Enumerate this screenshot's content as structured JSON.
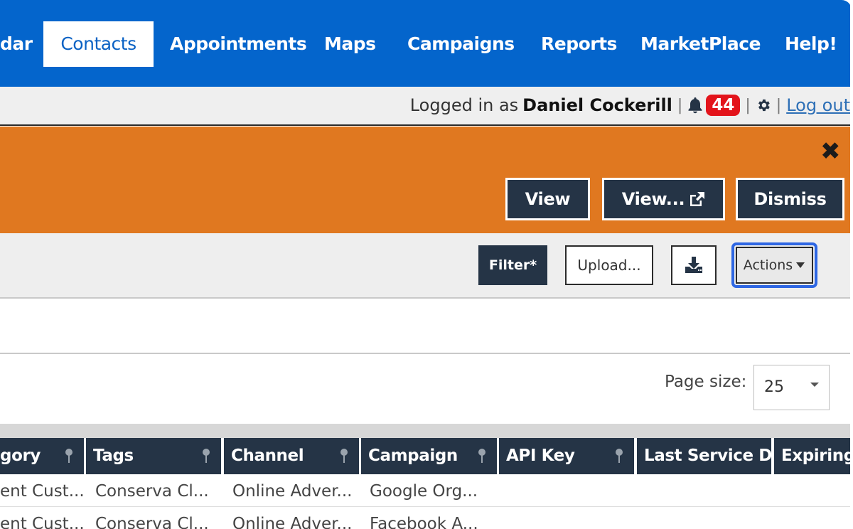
{
  "nav": {
    "items": [
      {
        "label": "dar",
        "active": false
      },
      {
        "label": "Contacts",
        "active": true
      },
      {
        "label": "Appointments",
        "active": false
      },
      {
        "label": "Maps",
        "active": false
      },
      {
        "label": "Campaigns",
        "active": false
      },
      {
        "label": "Reports",
        "active": false
      },
      {
        "label": "MarketPlace",
        "active": false
      },
      {
        "label": "Help!",
        "active": false
      }
    ]
  },
  "login": {
    "prefix": "Logged in as",
    "user": "Daniel Cockerill",
    "notification_count": "44",
    "separator": "|",
    "logout_label": "Log out"
  },
  "banner": {
    "close_label": "✖",
    "view_label": "View",
    "view_external_label": "View...",
    "dismiss_label": "Dismiss"
  },
  "toolbar": {
    "filter_label": "Filter*",
    "upload_label": "Upload...",
    "actions_label": "Actions"
  },
  "page_size": {
    "label": "Page size:",
    "value": "25"
  },
  "grid": {
    "columns": [
      "gory",
      "Tags",
      "Channel",
      "Campaign",
      "API Key",
      "Last Service Date",
      "Expiring"
    ],
    "rows": [
      [
        "ent Cust...",
        "Conserva Cl...",
        "Online Adver...",
        "Google Org...",
        "",
        "",
        ""
      ],
      [
        "ent Cust...",
        "Conserva Cl...",
        "Online Adver...",
        "Facebook A...",
        "",
        "",
        ""
      ]
    ]
  },
  "colors": {
    "nav_blue": "#0465cc",
    "banner_orange": "#e07820",
    "dark_button": "#253446",
    "badge_red": "#e3141b",
    "focus_ring": "#2f67e3"
  }
}
